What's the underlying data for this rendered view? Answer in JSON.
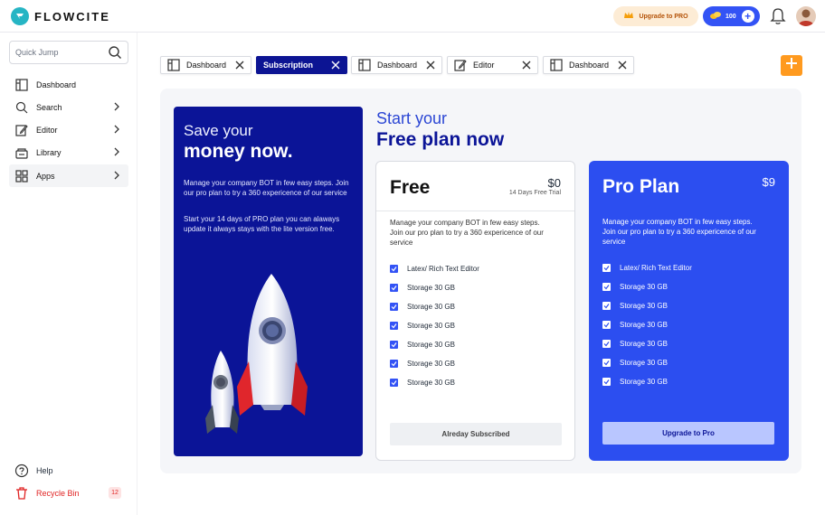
{
  "header": {
    "logo_text": "FLOWCITE",
    "upgrade_label": "Upgrade to PRO",
    "coins": "100"
  },
  "sidebar": {
    "search_placeholder": "Quick Jump",
    "items": [
      {
        "label": "Dashboard",
        "icon": "layout-icon"
      },
      {
        "label": "Search",
        "icon": "search-icon"
      },
      {
        "label": "Editor",
        "icon": "edit-icon"
      },
      {
        "label": "Library",
        "icon": "library-icon"
      },
      {
        "label": "Apps",
        "icon": "apps-grid-icon"
      }
    ],
    "help_label": "Help",
    "recycle_label": "Recycle Bin",
    "recycle_count": "12"
  },
  "tabs": [
    {
      "label": "Dashboard",
      "icon": "layout-icon"
    },
    {
      "label": "Subscription",
      "icon": "",
      "active": true
    },
    {
      "label": "Dashboard",
      "icon": "layout-icon"
    },
    {
      "label": "Editor",
      "icon": "edit-icon"
    },
    {
      "label": "Dashboard",
      "icon": "layout-icon"
    }
  ],
  "promo": {
    "title_line1": "Save your",
    "title_line2": "money now.",
    "paragraph1": "Manage your company BOT in few easy steps. Join our pro plan to try a 360 expericence of our service",
    "paragraph2": "Start your 14 days of PRO plan you can alaways update it always stays with the lite version free."
  },
  "heading": {
    "line1": "Start your",
    "line2": "Free plan now"
  },
  "plans": {
    "free": {
      "name": "Free",
      "price": "$0",
      "trial": "14 Days Free Trial",
      "description": "Manage your company BOT in few easy steps. Join our pro plan to try a 360 expericence of our service",
      "features": [
        "Latex/ Rich Text Editor",
        "Storage 30 GB",
        "Storage 30 GB",
        "Storage 30 GB",
        "Storage 30 GB",
        "Storage 30 GB",
        "Storage 30 GB"
      ],
      "button": "Alreday Subscribed"
    },
    "pro": {
      "name": "Pro Plan",
      "price": "$9",
      "description": "Manage your company BOT in few easy steps. Join our pro plan to try a 360 expericence of our service",
      "features": [
        "Latex/ Rich Text Editor",
        "Storage 30 GB",
        "Storage 30 GB",
        "Storage 30 GB",
        "Storage 30 GB",
        "Storage 30 GB",
        "Storage 30 GB"
      ],
      "button": "Upgrade to Pro"
    }
  },
  "colors": {
    "brand_navy": "#0b1497",
    "brand_blue": "#2c4ef0",
    "accent_orange": "#ff9a1f",
    "logo_teal": "#26b5c4",
    "danger_red": "#e02424"
  }
}
